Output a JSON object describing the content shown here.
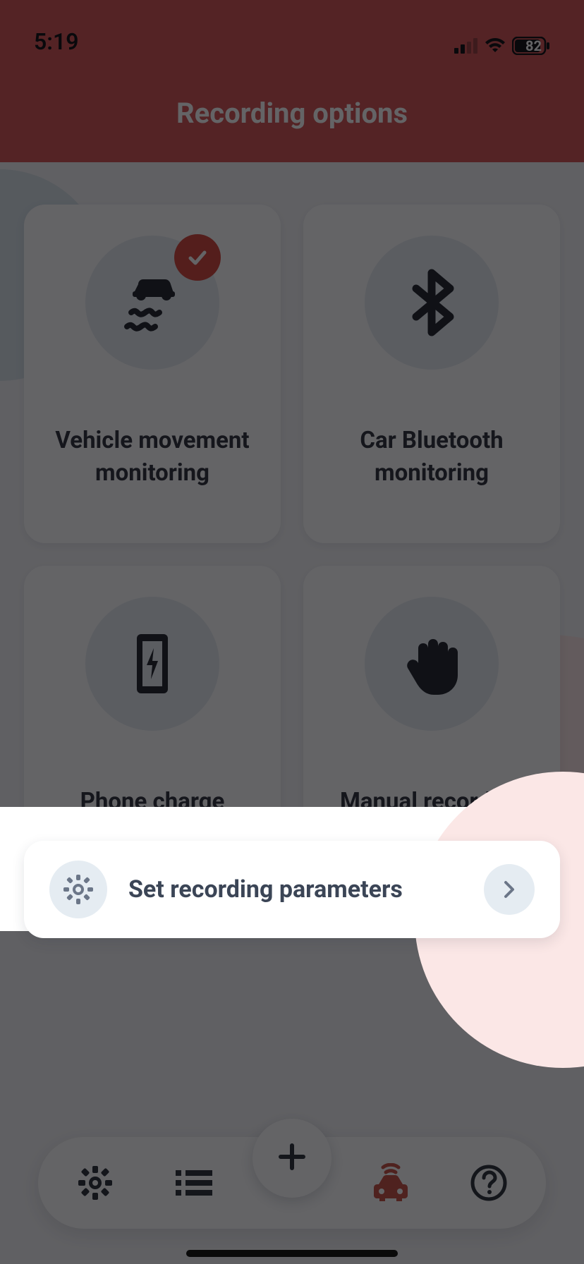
{
  "status": {
    "time": "5:19",
    "battery": "82"
  },
  "header": {
    "title": "Recording options"
  },
  "options": [
    {
      "label": "Vehicle movement monitoring",
      "selected": true
    },
    {
      "label": "Car Bluetooth monitoring",
      "selected": false
    },
    {
      "label": "Phone charge monitoring",
      "selected": false
    },
    {
      "label": "Manual recording",
      "selected": false
    }
  ],
  "params": {
    "label": "Set recording parameters"
  },
  "nav": {
    "items": [
      "settings",
      "list",
      "add",
      "car",
      "help"
    ]
  },
  "colors": {
    "accent": "#d55454",
    "badge": "#d4483d",
    "icon_bg": "#e6ecf2",
    "text": "#30343d"
  }
}
